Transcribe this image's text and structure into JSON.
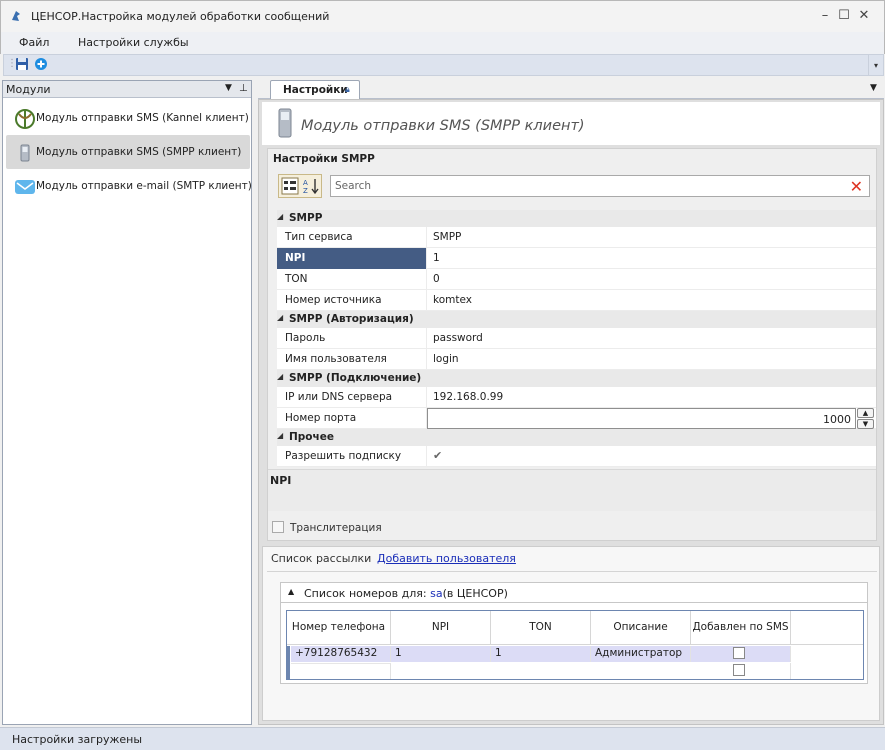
{
  "window": {
    "title": "ЦЕНСОР.Настройка модулей обработки сообщений"
  },
  "menu": {
    "items": [
      "Файл",
      "Настройки службы"
    ]
  },
  "modules": {
    "header": "Модули",
    "items": [
      {
        "label": "Модуль отправки SMS (Kannel клиент)",
        "icon": "kannel-icon"
      },
      {
        "label": "Модуль отправки SMS (SMPP клиент)",
        "icon": "phone-icon"
      },
      {
        "label": "Модуль отправки e-mail (SMTP клиент)",
        "icon": "mail-icon"
      }
    ]
  },
  "tab": {
    "label": "Настройки"
  },
  "module_title": "Модуль отправки SMS (SMPP клиент)",
  "settings": {
    "panel_title": "Настройки SMPP",
    "search_placeholder": "Search",
    "categories": [
      {
        "name": "SMPP",
        "rows": [
          {
            "key": "Тип сервиса",
            "value": "SMPP"
          },
          {
            "key": "NPI",
            "value": "1"
          },
          {
            "key": "TON",
            "value": "0"
          },
          {
            "key": "Номер источника",
            "value": "komtex"
          }
        ]
      },
      {
        "name": "SMPP (Авторизация)",
        "rows": [
          {
            "key": "Пароль",
            "value": "password"
          },
          {
            "key": "Имя пользователя",
            "value": "login"
          }
        ]
      },
      {
        "name": "SMPP (Подключение)",
        "rows": [
          {
            "key": "IP или DNS сервера",
            "value": "192.168.0.99"
          },
          {
            "key": "Номер порта",
            "value": "1000"
          }
        ]
      },
      {
        "name": "Прочее",
        "rows": [
          {
            "key": "Разрешить подписку",
            "value": "✔"
          }
        ]
      }
    ],
    "description_title": "NPI",
    "translit_label": "Транслитерация"
  },
  "recipients": {
    "label": "Список рассылки",
    "add_link": "Добавить пользователя",
    "group_prefix": "Список номеров для:",
    "group_user": "sa",
    "group_suffix": "(в ЦЕНСОР)",
    "columns": [
      "Номер телефона",
      "NPI",
      "TON",
      "Описание",
      "Добавлен по SMS"
    ],
    "rows": [
      {
        "phone": "+79128765432",
        "npi": "1",
        "ton": "1",
        "desc": "Администратор"
      }
    ]
  },
  "status": {
    "text": "Настройки загружены"
  }
}
